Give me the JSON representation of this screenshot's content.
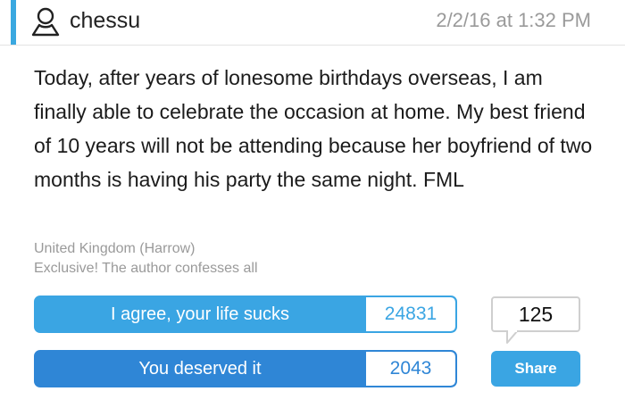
{
  "post": {
    "author": "chessu",
    "timestamp": "2/2/16 at 1:32 PM",
    "body": "Today, after years of lonesome birthdays overseas, I am finally able to celebrate the occasion at home. My best friend of 10 years will not be attending because her boyfriend of two months is having his party the same night. FML",
    "location": "United Kingdom (Harrow)",
    "tagline": "Exclusive! The author confesses all"
  },
  "votes": {
    "agree_label": "I agree, your life sucks",
    "agree_count": "24831",
    "deserved_label": "You deserved it",
    "deserved_count": "2043"
  },
  "actions": {
    "comment_count": "125",
    "share_label": "Share"
  },
  "icons": {
    "author": "user-outline-icon",
    "comments": "speech-bubble-icon"
  },
  "colors": {
    "accent": "#3aa8e0",
    "agree": "#3aa5e3",
    "deserved": "#2f86d6",
    "share": "#3aa5e3"
  }
}
